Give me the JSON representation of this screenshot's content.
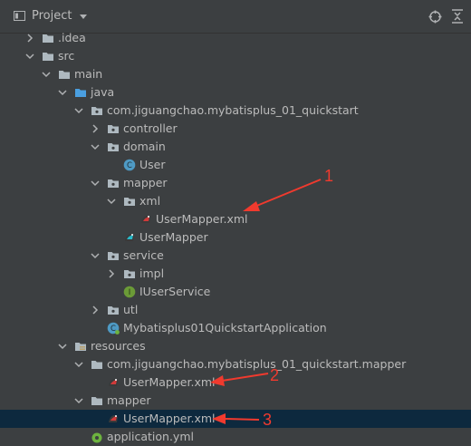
{
  "header": {
    "title": "Project",
    "icons": [
      "project-view-icon",
      "locate-icon",
      "collapse-all-icon"
    ]
  },
  "tree": [
    {
      "label": ".idea",
      "icon": "folder"
    },
    {
      "label": "src",
      "icon": "folder"
    },
    {
      "label": "main",
      "icon": "folder"
    },
    {
      "label": "java",
      "icon": "folder-source"
    },
    {
      "label": "com.jiguangchao.mybatisplus_01_quickstart",
      "icon": "package"
    },
    {
      "label": "controller",
      "icon": "package"
    },
    {
      "label": "domain",
      "icon": "package"
    },
    {
      "label": "User",
      "icon": "class"
    },
    {
      "label": "mapper",
      "icon": "package"
    },
    {
      "label": "xml",
      "icon": "package"
    },
    {
      "label": "UserMapper.xml",
      "icon": "mybatis-xml"
    },
    {
      "label": "UserMapper",
      "icon": "mybatis-interface"
    },
    {
      "label": "service",
      "icon": "package"
    },
    {
      "label": "impl",
      "icon": "package"
    },
    {
      "label": "IUserService",
      "icon": "interface"
    },
    {
      "label": "utl",
      "icon": "package"
    },
    {
      "label": "Mybatisplus01QuickstartApplication",
      "icon": "spring-boot-class"
    },
    {
      "label": "resources",
      "icon": "folder-resources"
    },
    {
      "label": "com.jiguangchao.mybatisplus_01_quickstart.mapper",
      "icon": "folder"
    },
    {
      "label": "UserMapper.xml",
      "icon": "mybatis-xml"
    },
    {
      "label": "mapper",
      "icon": "folder"
    },
    {
      "label": "UserMapper.xml",
      "icon": "mybatis-xml"
    },
    {
      "label": "application.yml",
      "icon": "yaml-config"
    }
  ],
  "annotations": {
    "a1": "1",
    "a2": "2",
    "a3": "3"
  },
  "colors": {
    "background": "#3c3f41",
    "selection": "#0d293e",
    "annotation": "#f03a2e",
    "folder": "#aeb9c0",
    "source_folder": "#4a9fe0",
    "resources_folder": "#b8a16e",
    "class": "#4e9ac4",
    "interface": "#6b9b37"
  }
}
